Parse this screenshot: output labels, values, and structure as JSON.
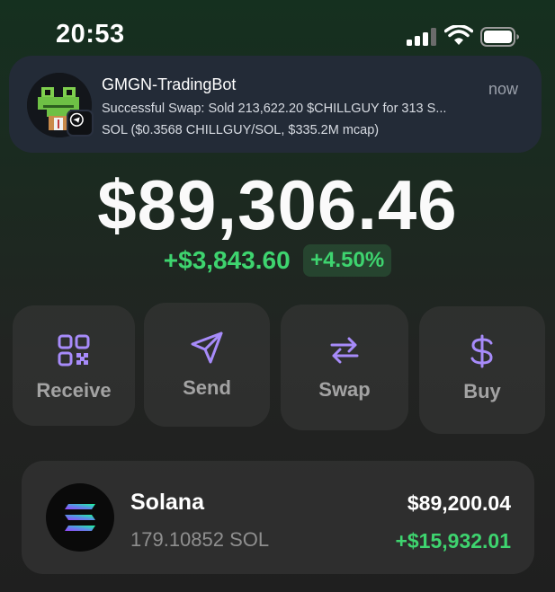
{
  "status_bar": {
    "time": "20:53"
  },
  "notification": {
    "app_name": "GMGN-TradingBot",
    "time": "now",
    "line1": "Successful Swap: Sold 213,622.20 $CHILLGUY for 313 S...",
    "line2": "SOL ($0.3568 CHILLGUY/SOL, $335.2M mcap)",
    "avatar_icon": "pixel-frog-icon",
    "badge_icon": "telegram-icon"
  },
  "portfolio": {
    "balance": "$89,306.46",
    "change_amount": "+$3,843.60",
    "change_percent": "+4.50%"
  },
  "actions": [
    {
      "label": "Receive",
      "icon": "qr-code-icon"
    },
    {
      "label": "Send",
      "icon": "send-icon"
    },
    {
      "label": "Swap",
      "icon": "swap-icon"
    },
    {
      "label": "Buy",
      "icon": "dollar-icon"
    }
  ],
  "tokens": [
    {
      "name": "Solana",
      "amount": "179.10852 SOL",
      "value": "$89,200.04",
      "change": "+$15,932.01",
      "icon": "solana-logo-icon"
    }
  ],
  "colors": {
    "accent_purple": "#a78bfa",
    "positive_green": "#3ed46f"
  }
}
